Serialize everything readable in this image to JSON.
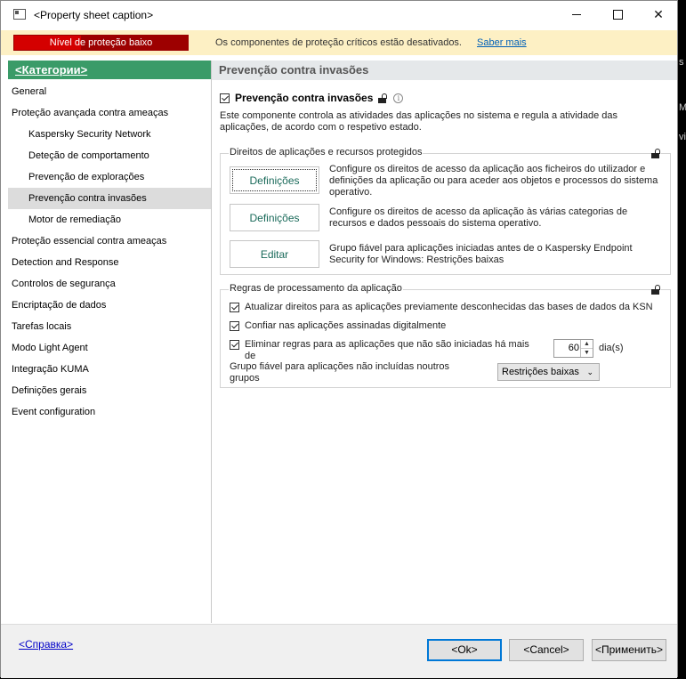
{
  "window": {
    "title": "<Property sheet caption>"
  },
  "warning_bar": {
    "badge_label": "Nível de proteção baixo",
    "message": "Os componentes de proteção críticos estão desativados.",
    "link_label": "Saber mais",
    "badge_color": "#d40000",
    "background_color": "#fdf0c4"
  },
  "sidebar": {
    "heading": "<Категории>",
    "heading_color": "#3a9b68",
    "items": [
      {
        "label": "General",
        "level": 0
      },
      {
        "label": "Proteção avançada contra ameaças",
        "level": 0
      },
      {
        "label": "Kaspersky Security Network",
        "level": 1
      },
      {
        "label": "Deteção de comportamento",
        "level": 1
      },
      {
        "label": "Prevenção de explorações",
        "level": 1
      },
      {
        "label": "Prevenção contra invasões",
        "level": 1,
        "selected": true
      },
      {
        "label": "Motor de remediação",
        "level": 1
      },
      {
        "label": "Proteção essencial contra ameaças",
        "level": 0
      },
      {
        "label": "Detection and Response",
        "level": 0
      },
      {
        "label": "Controlos de segurança",
        "level": 0
      },
      {
        "label": "Encriptação de dados",
        "level": 0
      },
      {
        "label": "Tarefas locais",
        "level": 0
      },
      {
        "label": "Modo Light Agent",
        "level": 0
      },
      {
        "label": "Integração KUMA",
        "level": 0
      },
      {
        "label": "Definições gerais",
        "level": 0
      },
      {
        "label": "Event configuration",
        "level": 0
      }
    ]
  },
  "main": {
    "heading": "Prevenção contra invasões",
    "feature": {
      "checked": true,
      "title": "Prevenção contra invasões",
      "info_glyph": "i",
      "description": "Este componente controla as atividades das aplicações no sistema e regula a atividade das aplicações, de acordo com o respetivo estado."
    },
    "rights_group": {
      "title": "Direitos de aplicações e recursos protegidos",
      "rows": [
        {
          "button": "Definições",
          "text": "Configure os direitos de acesso da aplicação aos ficheiros do utilizador e definições da aplicação ou para aceder aos objetos e processos do sistema operativo."
        },
        {
          "button": "Definições",
          "text": "Configure os direitos de acesso da aplicação às várias categorias de recursos e dados pessoais do sistema operativo."
        },
        {
          "button": "Editar",
          "text": "Grupo fiável para aplicações iniciadas antes de o Kaspersky Endpoint Security for Windows: Restrições baixas"
        }
      ]
    },
    "processing_group": {
      "title": "Regras de processamento da aplicação",
      "update_rights": {
        "checked": true,
        "label": "Atualizar direitos para as aplicações previamente desconhecidas das bases de dados da KSN"
      },
      "trust_signed": {
        "checked": true,
        "label": "Confiar nas aplicações assinadas digitalmente"
      },
      "delete_rules": {
        "checked": true,
        "label": "Eliminar regras para as aplicações que não são iniciadas há mais de",
        "days_value": "60",
        "days_unit": "dia(s)"
      },
      "trusted_group": {
        "label": "Grupo fiável para aplicações não incluídas noutros grupos",
        "selected": "Restrições baixas"
      }
    }
  },
  "footer": {
    "help_link": "<Справка>",
    "ok_label": "<Ok>",
    "cancel_label": "<Cancel>",
    "apply_label": "<Применить>"
  },
  "background_window": {
    "fragments": [
      "s",
      "Ma",
      "vi"
    ]
  }
}
